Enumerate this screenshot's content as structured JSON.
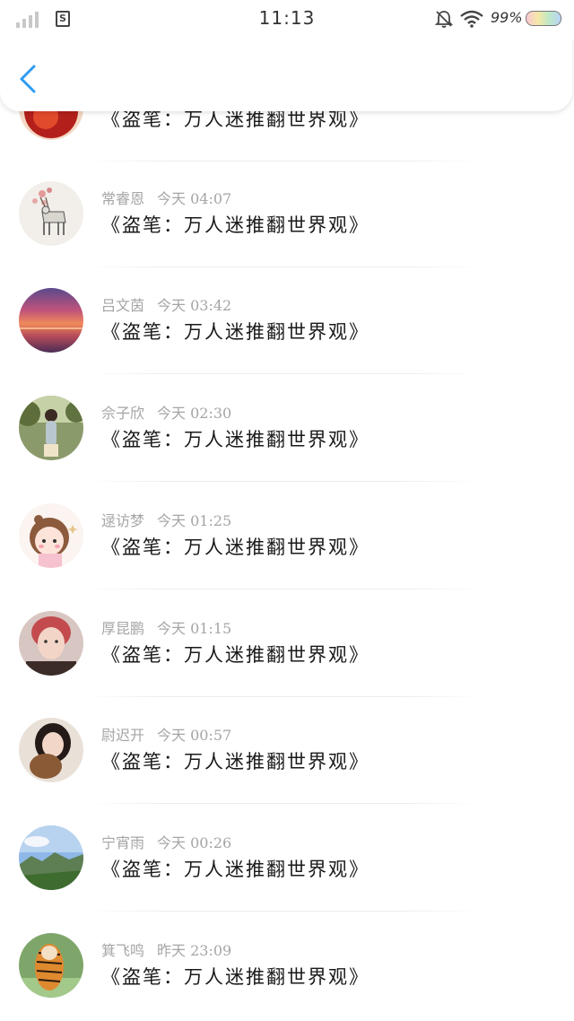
{
  "status_bar": {
    "time": "11:13",
    "battery_percent": "99%",
    "sim_label": "S",
    "icons": [
      "signal-icon",
      "sim-icon",
      "bell-off-icon",
      "wifi-icon",
      "battery-icon"
    ]
  },
  "header": {
    "back_icon": "chevron-left-icon",
    "accent_color": "#2f9bf0"
  },
  "list": {
    "items": [
      {
        "name": "",
        "time": "",
        "title": "《盗笔：万人迷推翻世界观》",
        "avatar": "red-flower-image"
      },
      {
        "name": "常睿恩",
        "time": "今天 04:07",
        "title": "《盗笔：万人迷推翻世界观》",
        "avatar": "deer-blossom-image"
      },
      {
        "name": "吕文茵",
        "time": "今天 03:42",
        "title": "《盗笔：万人迷推翻世界观》",
        "avatar": "sunset-sea-image"
      },
      {
        "name": "佘子欣",
        "time": "今天 02:30",
        "title": "《盗笔：万人迷推翻世界观》",
        "avatar": "girl-garden-image"
      },
      {
        "name": "逯访梦",
        "time": "今天 01:25",
        "title": "《盗笔：万人迷推翻世界观》",
        "avatar": "cartoon-girl-image"
      },
      {
        "name": "厚昆鹏",
        "time": "今天 01:15",
        "title": "《盗笔：万人迷推翻世界观》",
        "avatar": "red-hair-boy-image"
      },
      {
        "name": "尉迟开",
        "time": "今天 00:57",
        "title": "《盗笔：万人迷推翻世界观》",
        "avatar": "girl-teddy-bear-image"
      },
      {
        "name": "宁宵雨",
        "time": "今天 00:26",
        "title": "《盗笔：万人迷推翻世界观》",
        "avatar": "mountain-landscape-image"
      },
      {
        "name": "箕飞鸣",
        "time": "昨天 23:09",
        "title": "《盗笔：万人迷推翻世界观》",
        "avatar": "tiger-image"
      }
    ]
  }
}
